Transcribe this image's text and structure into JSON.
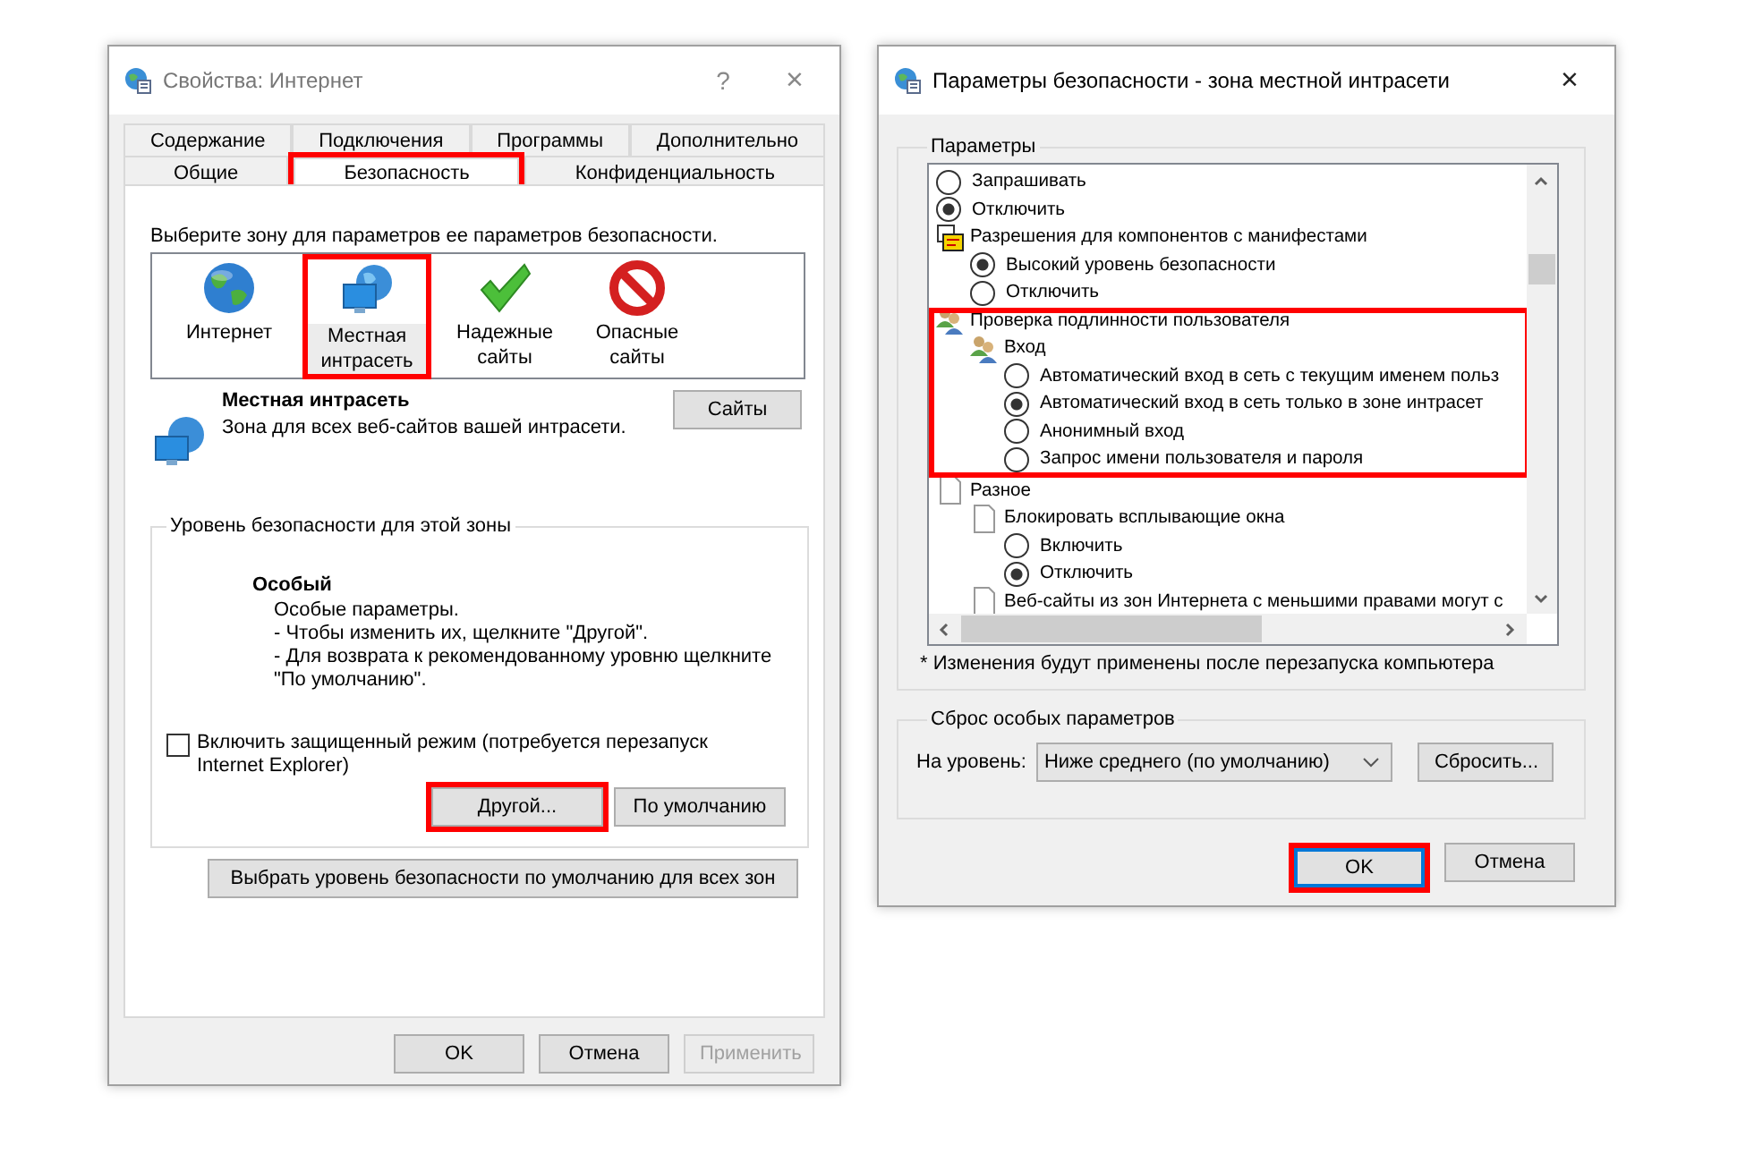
{
  "internet_options": {
    "title": "Свойства: Интернет",
    "help_button": "?",
    "close_button": "×",
    "tabs_row_1": [
      {
        "label": "Содержание",
        "selected": false,
        "highlighted": false
      },
      {
        "label": "Подключения",
        "selected": false,
        "highlighted": false
      },
      {
        "label": "Программы",
        "selected": false,
        "highlighted": false
      },
      {
        "label": "Дополнительно",
        "selected": false,
        "highlighted": false
      }
    ],
    "tabs_row_2": [
      {
        "label": "Общие",
        "selected": false,
        "highlighted": false
      },
      {
        "label": "Безопасность",
        "selected": true,
        "highlighted": true
      },
      {
        "label": "Конфиденциальность",
        "selected": false,
        "highlighted": false
      }
    ],
    "zone_prompt": "Выберите зону для параметров ее параметров безопасности.",
    "zones": [
      {
        "kind": "internet",
        "label": "Интернет",
        "selected": false,
        "highlighted": false
      },
      {
        "kind": "intranet",
        "label": "Местная интрасеть",
        "selected": true,
        "highlighted": true
      },
      {
        "kind": "trusted",
        "label": "Надежные сайты",
        "selected": false,
        "highlighted": false
      },
      {
        "kind": "restricted",
        "label": "Опасные сайты",
        "selected": false,
        "highlighted": false
      }
    ],
    "zone_title": "Местная интрасеть",
    "zone_description": "Зона для всех веб-сайтов вашей интрасети.",
    "sites_button": "Сайты",
    "level_group": {
      "title": "Уровень безопасности для этой зоны",
      "level_name": "Особый",
      "description_lines": [
        "Особые параметры.",
        "- Чтобы изменить их, щелкните \"Другой\".",
        "- Для возврата к рекомендованному уровню щелкните",
        "\"По умолчанию\"."
      ],
      "protected_mode": {
        "label": "Включить защищенный режим (потребуется перезапуск Internet Explorer)",
        "checked": false
      },
      "buttons": [
        {
          "label": "Другой...",
          "highlighted": true
        },
        {
          "label": "По умолчанию",
          "highlighted": false
        }
      ]
    },
    "reset_all_button": "Выбрать уровень безопасности по умолчанию для всех зон",
    "footer_buttons": [
      {
        "label": "OK",
        "disabled": false
      },
      {
        "label": "Отмена",
        "disabled": false
      },
      {
        "label": "Применить",
        "disabled": true
      }
    ]
  },
  "security_settings": {
    "title": "Параметры безопасности - зона местной интрасети",
    "close_button": "×",
    "settings_group": "Параметры",
    "tree": [
      {
        "children": [
          {
            "children": [
              {
                "kind": "radio",
                "label": "Запрашивать",
                "selected": false
              },
              {
                "kind": "radio",
                "label": "Отключить",
                "selected": true
              }
            ]
          },
          {
            "kind": "component",
            "label": "Разрешения для компонентов с манифестами",
            "children": [
              {
                "kind": "radio",
                "label": "Высокий уровень безопасности",
                "selected": true
              },
              {
                "kind": "radio",
                "label": "Отключить",
                "selected": false
              }
            ]
          }
        ]
      },
      {
        "kind": "users",
        "label": "Проверка подлинности пользователя",
        "highlighted": true,
        "children": [
          {
            "kind": "users",
            "label": "Вход",
            "children": [
              {
                "kind": "radio",
                "label": "Автоматический вход в сеть с текущим именем польз",
                "selected": false
              },
              {
                "kind": "radio",
                "label": "Автоматический вход в сеть только в зоне интрасет",
                "selected": true
              },
              {
                "kind": "radio",
                "label": "Анонимный вход",
                "selected": false
              },
              {
                "kind": "radio",
                "label": "Запрос имени пользователя и пароля",
                "selected": false
              }
            ]
          }
        ]
      },
      {
        "kind": "page",
        "label": "Разное",
        "highlighted": false,
        "children": [
          {
            "kind": "page",
            "label": "Блокировать всплывающие окна",
            "children": [
              {
                "kind": "radio",
                "label": "Включить",
                "selected": false
              },
              {
                "kind": "radio",
                "label": "Отключить",
                "selected": true
              }
            ]
          },
          {
            "kind": "page",
            "label": "Веб-сайты из зон Интернета с меньшими правами могут с"
          }
        ]
      }
    ],
    "restart_note": "* Изменения будут применены после перезапуска компьютера",
    "reset_group": {
      "title": "Сброс особых параметров",
      "level_label": "На уровень:",
      "level_value": "Ниже среднего (по умолчанию)",
      "reset_button": "Сбросить..."
    },
    "footer_buttons": [
      {
        "label": "OK",
        "focused": true,
        "highlighted": true
      },
      {
        "label": "Отмена",
        "focused": false,
        "highlighted": false
      }
    ]
  }
}
